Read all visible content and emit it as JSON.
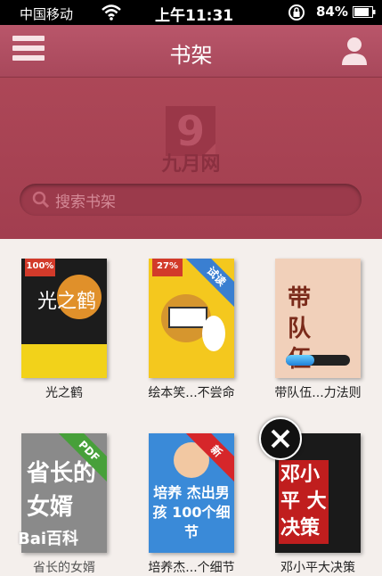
{
  "status_bar": {
    "carrier": "中国移动",
    "time": "上午11:31",
    "battery_percent": "84%"
  },
  "header": {
    "title": "书架",
    "logo_text": "九月网"
  },
  "search": {
    "placeholder": "搜索书架"
  },
  "books": [
    {
      "title": "光之鹤",
      "progress_badge": "100%",
      "cover_title": "光之鹤",
      "cover_color": "#1c1c1c"
    },
    {
      "title": "绘本笑...不尝命",
      "progress_badge": "27%",
      "ribbon": "试读",
      "ribbon_color": "#3a7fd1",
      "cover_color": "#f4c81e"
    },
    {
      "title": "带队伍...力法则",
      "cover_title": "带队伍",
      "cover_color": "#f1d0ba",
      "download_progress": 0.45
    },
    {
      "title": "省长的女婿",
      "ribbon": "PDF",
      "ribbon_color": "#47a03a",
      "cover_title": "省长的女婿",
      "cover_color": "#8a8a8a"
    },
    {
      "title": "培养杰...个细节",
      "ribbon": "新",
      "ribbon_color": "#d6262a",
      "cover_title": "培养 杰出男孩 100个细节",
      "cover_color": "#3a8ad8"
    },
    {
      "title": "邓小平大决策",
      "cover_title": "邓小平 大决策",
      "cover_color": "#1a1a1a"
    }
  ],
  "watermark": "Bai百科"
}
